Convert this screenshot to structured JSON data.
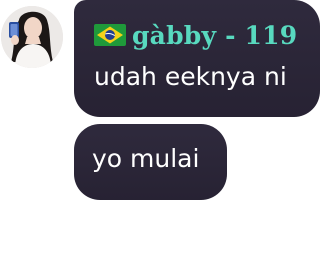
{
  "messages": [
    {
      "sender": "gàbby - 119",
      "flag_icon": "brazil-flag-icon",
      "text": "udah eeknya ni"
    },
    {
      "text": "yo mulai"
    }
  ],
  "colors": {
    "bubble": "#2b2638",
    "username": "#58d9bf",
    "text": "#ffffff",
    "background": "#ffffff"
  },
  "avatar_icon": "user-avatar-photo"
}
